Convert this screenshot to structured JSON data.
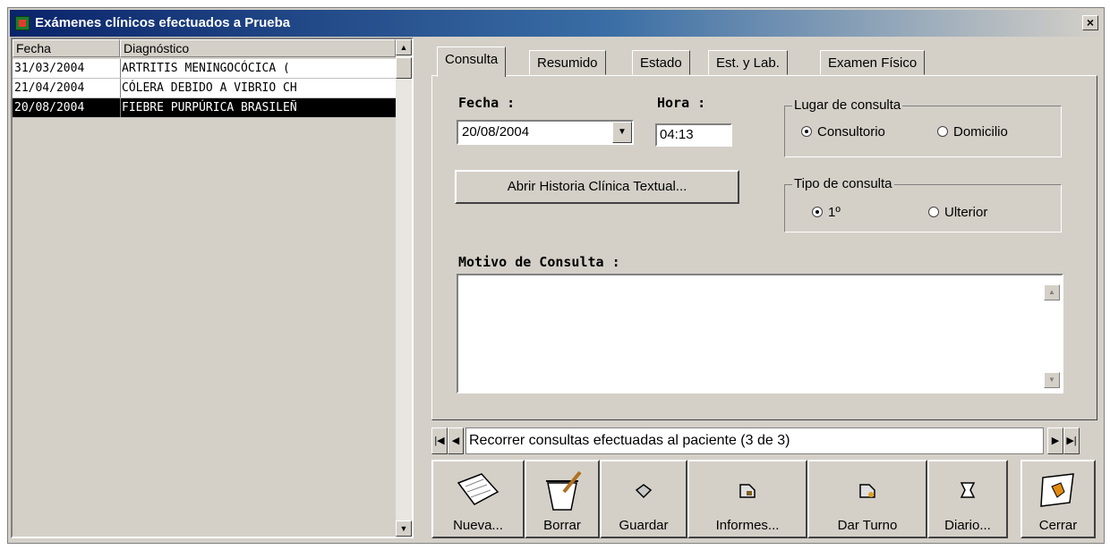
{
  "window": {
    "title": "Exámenes clínicos efectuados a Prueba",
    "close": "×"
  },
  "list": {
    "columns": [
      "Fecha",
      "Diagnóstico"
    ],
    "rows": [
      {
        "fecha": "31/03/2004",
        "diag": "ARTRITIS MENINGOCÓCICA ("
      },
      {
        "fecha": "21/04/2004",
        "diag": "CÓLERA DEBIDO A VIBRIO CH"
      },
      {
        "fecha": "20/08/2004",
        "diag": "FIEBRE PURPÚRICA BRASILEÑ"
      }
    ],
    "selected_index": 2
  },
  "tabs": [
    {
      "label": "Consulta",
      "active": true
    },
    {
      "label": "Resumido"
    },
    {
      "label": "Estado"
    },
    {
      "label": "Est. y Lab."
    },
    {
      "label": "Examen Físico"
    }
  ],
  "form": {
    "fecha_label": "Fecha :",
    "fecha_value": "20/08/2004",
    "hora_label": "Hora :",
    "hora_value": "04:13",
    "lugar": {
      "legend": "Lugar de consulta",
      "options": [
        "Consultorio",
        "Domicilio"
      ],
      "selected": "Consultorio"
    },
    "tipo": {
      "legend": "Tipo de consulta",
      "options": [
        "1º",
        "Ulterior"
      ],
      "selected": "1º"
    },
    "historia_button": "Abrir Historia Clínica Textual...",
    "motivo_label": "Motivo de Consulta :",
    "motivo_value": ""
  },
  "navigator": {
    "text": "Recorrer consultas efectuadas al paciente (3 de 3)"
  },
  "toolbar": {
    "nueva": "Nueva...",
    "borrar": "Borrar",
    "guardar": "Guardar",
    "informes": "Informes...",
    "dar_turno": "Dar Turno",
    "diario": "Diario...",
    "cerrar": "Cerrar"
  }
}
